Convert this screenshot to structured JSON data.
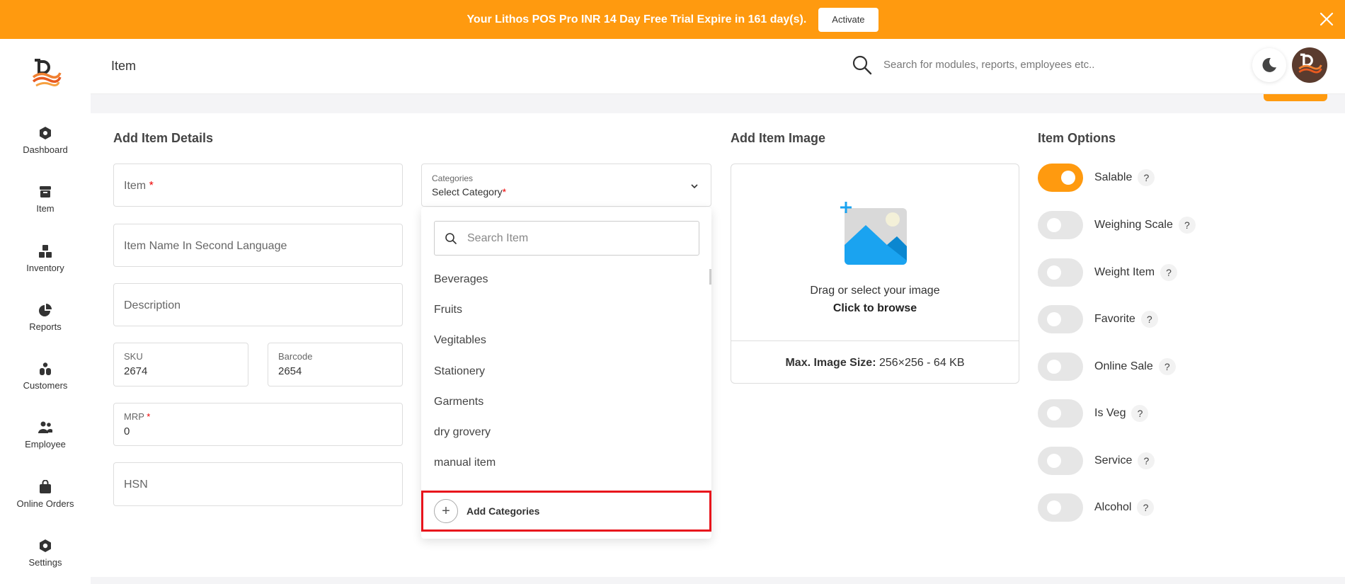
{
  "banner": {
    "message": "Your Lithos POS Pro INR 14 Day Free Trial Expire in 161 day(s).",
    "activate_label": "Activate"
  },
  "sidebar": {
    "items": [
      {
        "label": "Dashboard",
        "icon": "dashboard-icon"
      },
      {
        "label": "Item",
        "icon": "box-icon"
      },
      {
        "label": "Inventory",
        "icon": "boxes-icon"
      },
      {
        "label": "Reports",
        "icon": "pie-chart-icon"
      },
      {
        "label": "Customers",
        "icon": "users-icon"
      },
      {
        "label": "Employee",
        "icon": "employee-icon"
      },
      {
        "label": "Online Orders",
        "icon": "bag-icon"
      },
      {
        "label": "Settings",
        "icon": "settings-icon"
      }
    ]
  },
  "header": {
    "title": "Item",
    "search_placeholder": "Search for modules, reports, employees etc.."
  },
  "details": {
    "title": "Add Item Details",
    "item_placeholder": "Item",
    "item_required": "*",
    "second_lang_placeholder": "Item Name In Second Language",
    "description_placeholder": "Description",
    "sku_label": "SKU",
    "sku_value": "2674",
    "barcode_label": "Barcode",
    "barcode_value": "2654",
    "mrp_label": "MRP",
    "mrp_required": "*",
    "mrp_value": "0",
    "hsn_placeholder": "HSN"
  },
  "categories": {
    "label": "Categories",
    "value": "Select Category",
    "required": "*",
    "search_placeholder": "Search Item",
    "options": [
      "Beverages",
      "Fruits",
      "Vegitables",
      "Stationery",
      "Garments",
      "dry grovery",
      "manual item"
    ],
    "add_label": "Add Categories"
  },
  "image": {
    "title": "Add Item Image",
    "drag_text": "Drag or select your image",
    "browse_text": "Click to browse",
    "max_label": "Max. Image Size:",
    "max_value": "256×256 - 64 KB"
  },
  "options": {
    "title": "Item Options",
    "help": "?",
    "items": [
      {
        "label": "Salable",
        "on": true
      },
      {
        "label": "Weighing Scale",
        "on": false
      },
      {
        "label": "Weight Item",
        "on": false
      },
      {
        "label": "Favorite",
        "on": false
      },
      {
        "label": "Online Sale",
        "on": false
      },
      {
        "label": "Is Veg",
        "on": false
      },
      {
        "label": "Service",
        "on": false
      },
      {
        "label": "Alcohol",
        "on": false
      }
    ]
  },
  "colors": {
    "accent": "#ff9a0f",
    "highlight": "#e8141c"
  }
}
